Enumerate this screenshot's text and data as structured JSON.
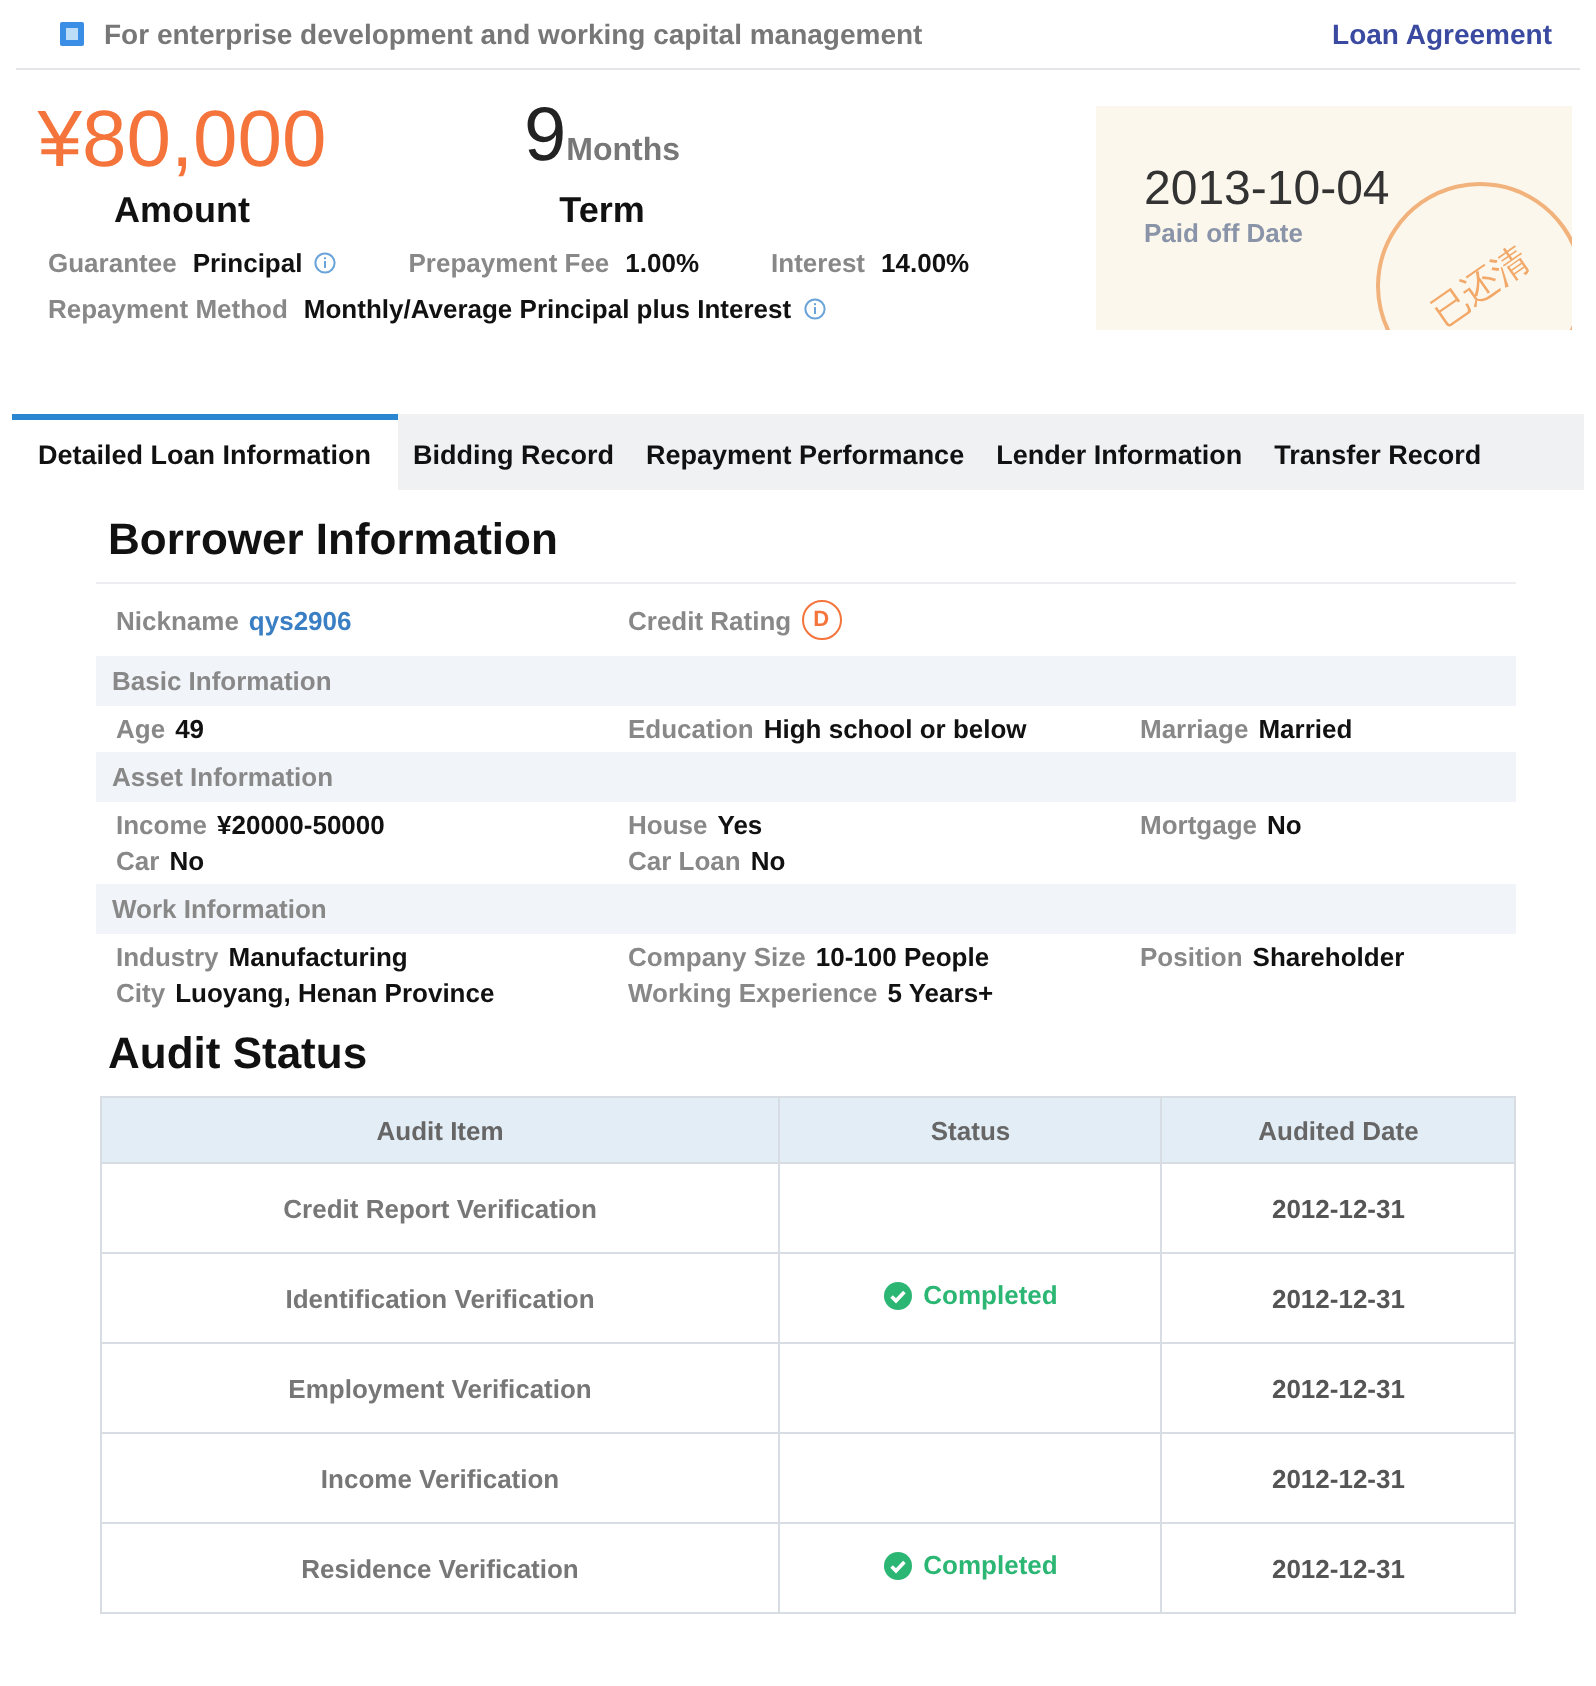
{
  "header": {
    "title": "For enterprise development and working capital management",
    "link": "Loan Agreement"
  },
  "summary": {
    "amount": {
      "value": "¥80,000",
      "label": "Amount"
    },
    "term": {
      "number": "9",
      "unit": "Months",
      "label": "Term"
    },
    "details": [
      [
        {
          "label": "Guarantee",
          "value": "Principal",
          "info": true
        },
        {
          "label": "Prepayment Fee",
          "value": "1.00%",
          "info": false
        },
        {
          "label": "Interest",
          "value": "14.00%",
          "info": false
        }
      ],
      [
        {
          "label": "Repayment Method",
          "value": "Monthly/Average Principal plus Interest",
          "info": true
        }
      ]
    ],
    "paid_off": {
      "date": "2013-10-04",
      "label": "Paid off Date",
      "stamp": "已还清"
    }
  },
  "tabs": [
    {
      "label": "Detailed Loan Information",
      "selected": true
    },
    {
      "label": "Bidding Record",
      "selected": false
    },
    {
      "label": "Repayment Performance",
      "selected": false
    },
    {
      "label": "Lender Information",
      "selected": false
    },
    {
      "label": "Transfer Record",
      "selected": false
    }
  ],
  "borrower": {
    "title": "Borrower Information",
    "nickname": {
      "label": "Nickname",
      "value": "qys2906"
    },
    "credit_rating": {
      "label": "Credit Rating",
      "value": "D"
    },
    "groups": [
      {
        "title": "Basic Information",
        "columns": [
          [
            {
              "label": "Age",
              "value": "49"
            }
          ],
          [
            {
              "label": "Education",
              "value": "High school or below"
            }
          ],
          [
            {
              "label": "Marriage",
              "value": "Married"
            }
          ]
        ]
      },
      {
        "title": "Asset Information",
        "columns": [
          [
            {
              "label": "Income",
              "value": "¥20000-50000"
            },
            {
              "label": "Car",
              "value": "No"
            }
          ],
          [
            {
              "label": "House",
              "value": "Yes"
            },
            {
              "label": "Car Loan",
              "value": "No"
            }
          ],
          [
            {
              "label": "Mortgage",
              "value": "No"
            }
          ]
        ]
      },
      {
        "title": "Work Information",
        "columns": [
          [
            {
              "label": "Industry",
              "value": "Manufacturing"
            },
            {
              "label": "City",
              "value": "Luoyang, Henan Province"
            }
          ],
          [
            {
              "label": "Company Size",
              "value": "10-100 People"
            },
            {
              "label": "Working Experience",
              "value": "5 Years+"
            }
          ],
          [
            {
              "label": "Position",
              "value": "Shareholder"
            }
          ]
        ]
      }
    ]
  },
  "audit": {
    "title": "Audit Status",
    "columns": [
      "Audit Item",
      "Status",
      "Audited Date"
    ],
    "rows": [
      {
        "item": "Credit Report Verification",
        "date": "2012-12-31"
      },
      {
        "item": "Identification Verification",
        "status": "Completed",
        "date": "2012-12-31"
      },
      {
        "item": "Employment Verification",
        "date": "2012-12-31"
      },
      {
        "item": "Income Verification",
        "date": "2012-12-31"
      },
      {
        "item": "Residence Verification",
        "status": "Completed",
        "date": "2012-12-31"
      }
    ]
  }
}
